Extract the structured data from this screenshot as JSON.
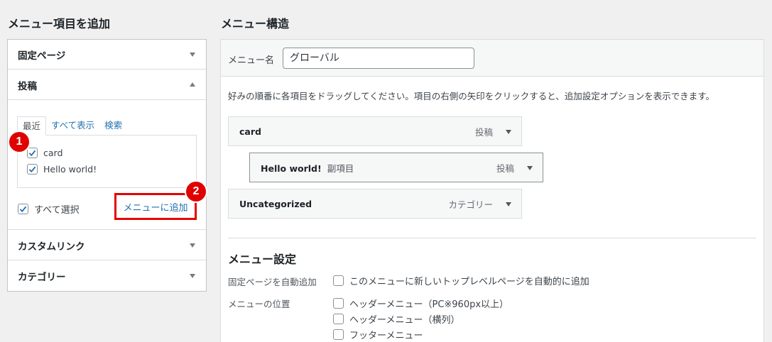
{
  "left": {
    "heading": "メニュー項目を追加",
    "sections": {
      "pages": "固定ページ",
      "posts": "投稿",
      "custom_links": "カスタムリンク",
      "categories": "カテゴリー"
    },
    "tabs": [
      "最近",
      "すべて表示",
      "検索"
    ],
    "items": [
      {
        "label": "card",
        "checked": true
      },
      {
        "label": "Hello world!",
        "checked": true
      }
    ],
    "select_all": "すべて選択",
    "add_button": "メニューに追加",
    "badges": [
      "1",
      "2"
    ]
  },
  "right": {
    "heading": "メニュー構造",
    "name_label": "メニュー名",
    "name_value": "グローバル",
    "instructions": "好みの順番に各項目をドラッグしてください。項目の右側の矢印をクリックすると、追加設定オプションを表示できます。",
    "menu_items": [
      {
        "title": "card",
        "sub_tag": "",
        "type": "投稿"
      },
      {
        "title": "Hello world!",
        "sub_tag": "副項目",
        "type": "投稿"
      },
      {
        "title": "Uncategorized",
        "sub_tag": "",
        "type": "カテゴリー"
      }
    ],
    "settings": {
      "title": "メニュー設定",
      "auto_add_label": "固定ページを自動追加",
      "auto_add_option": "このメニューに新しいトップレベルページを自動的に追加",
      "location_label": "メニューの位置",
      "locations": [
        "ヘッダーメニュー（PC※960px以上）",
        "ヘッダーメニュー（横列）",
        "フッターメニュー"
      ]
    }
  },
  "colors": {
    "accent": "#2271b1",
    "highlight": "#e60000"
  }
}
